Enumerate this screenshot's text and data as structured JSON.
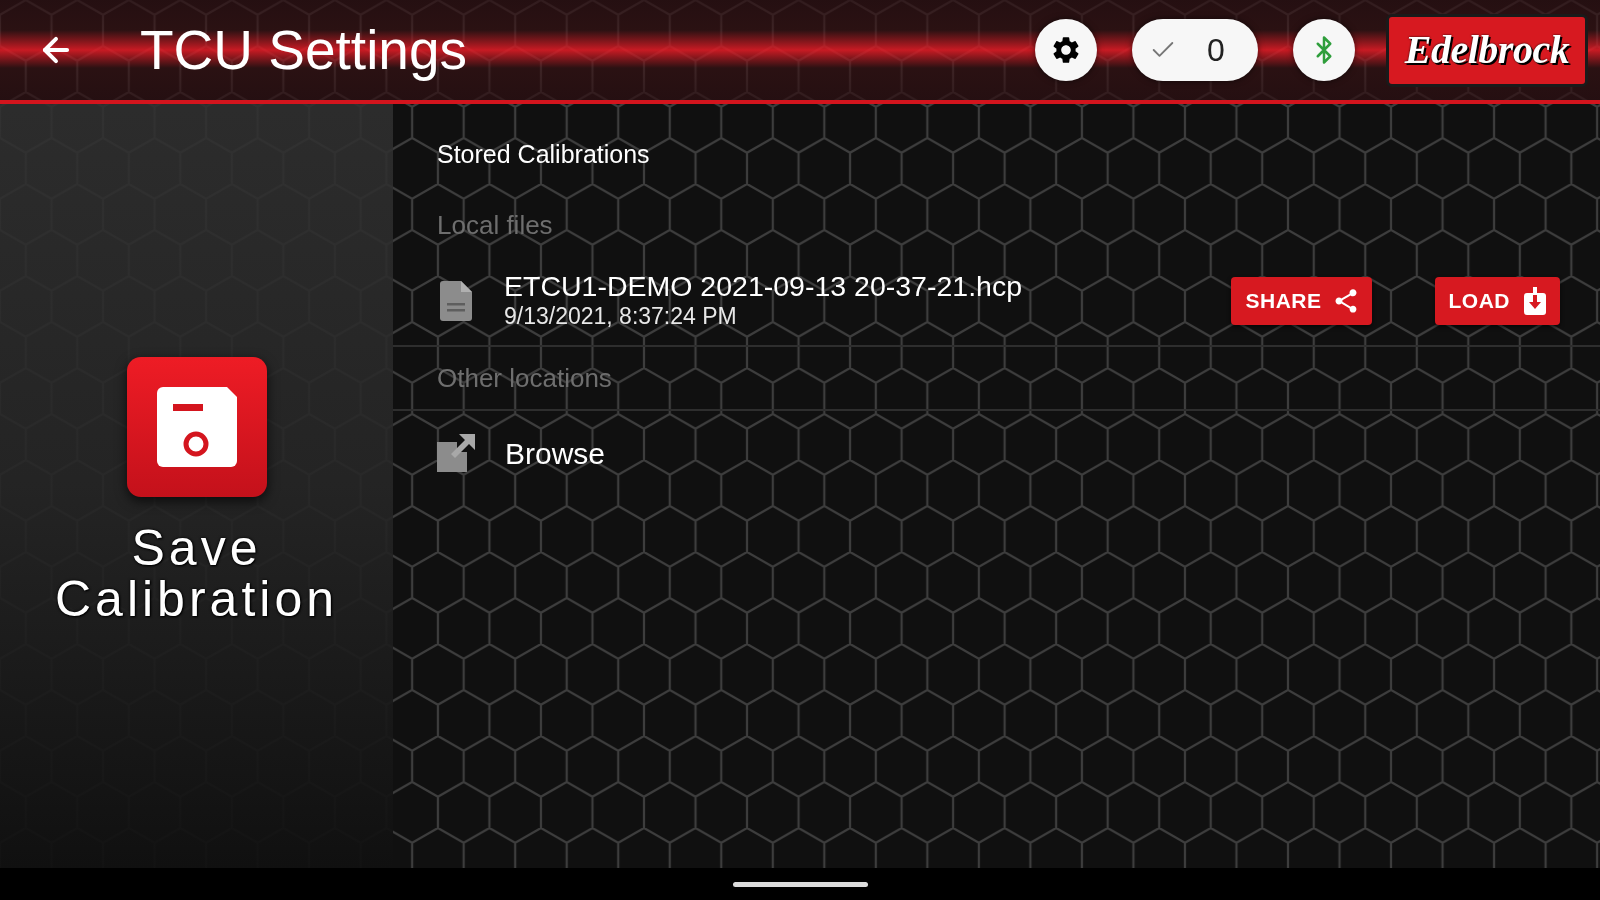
{
  "header": {
    "title": "TCU Settings",
    "counter": "0",
    "logo": "Edelbrock"
  },
  "save_panel": {
    "label": "Save Calibration"
  },
  "content": {
    "title": "Stored Calibrations",
    "sections": [
      {
        "heading": "Local files",
        "items": [
          {
            "kind": "file",
            "name": "ETCU1-DEMO 2021-09-13 20-37-21.hcp",
            "date": "9/13/2021, 8:37:24 PM",
            "actions": [
              {
                "kind": "share",
                "label": "SHARE"
              },
              {
                "kind": "load",
                "label": "LOAD"
              }
            ]
          }
        ]
      },
      {
        "heading": "Other locations",
        "items": [
          {
            "kind": "browse",
            "name": "Browse"
          }
        ]
      }
    ]
  }
}
